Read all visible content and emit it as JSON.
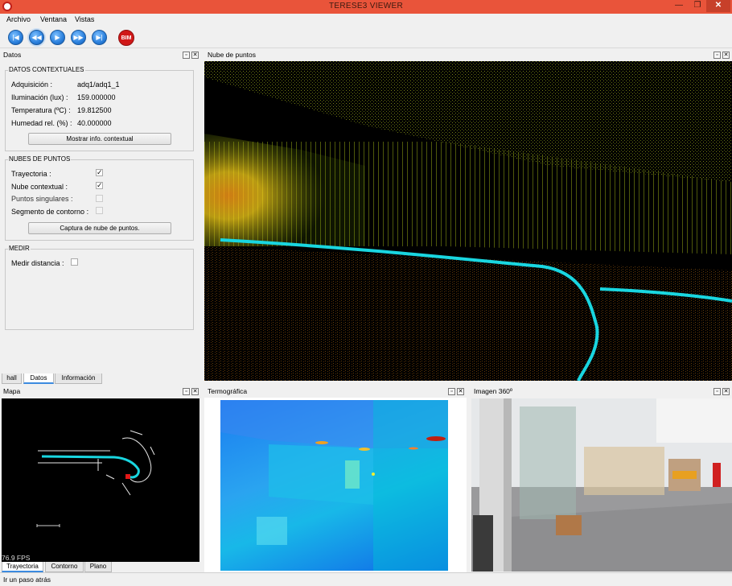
{
  "window": {
    "title": "TERESE3 VIEWER",
    "min": "—",
    "max": "❐",
    "close": "✕"
  },
  "menu": [
    "Archivo",
    "Ventana",
    "Vistas"
  ],
  "toolbar": {
    "bim_label": "BIM"
  },
  "datos_panel": {
    "title": "Datos",
    "contextual": {
      "heading": "DATOS CONTEXTUALES",
      "rows": [
        {
          "label": "Adquisición :",
          "value": "adq1/adq1_1"
        },
        {
          "label": "Iluminación (lux) :",
          "value": "159.000000"
        },
        {
          "label": "Temperatura (ºC) :",
          "value": "19.812500"
        },
        {
          "label": "Humedad rel. (%) :",
          "value": "40.000000"
        }
      ],
      "button": "Mostrar info. contextual"
    },
    "nubes": {
      "heading": "NUBES DE PUNTOS",
      "rows": [
        {
          "label": "Trayectoria :",
          "checked": true,
          "enabled": true
        },
        {
          "label": "Nube contextual :",
          "checked": true,
          "enabled": true
        },
        {
          "label": "Puntos singulares :",
          "checked": false,
          "enabled": false
        },
        {
          "label": "Segmento de contorno :",
          "checked": false,
          "enabled": false
        }
      ],
      "button": "Captura de nube de puntos."
    },
    "medir": {
      "heading": "MEDIR",
      "label": "Medir distancia :",
      "checked": false
    },
    "tabs": [
      "hall",
      "Datos",
      "Información"
    ],
    "selected_tab": "Datos"
  },
  "nube_panel": {
    "title": "Nube de puntos"
  },
  "mapa_panel": {
    "title": "Mapa",
    "fps": "76.9 FPS",
    "tabs": [
      "Trayectoria",
      "Contorno",
      "Plano"
    ],
    "selected_tab": "Trayectoria"
  },
  "termo_panel": {
    "title": "Termográfica"
  },
  "imagen_panel": {
    "title": "Imagen 360º"
  },
  "status": {
    "text": "Ir un paso atrás"
  },
  "colors": {
    "titlebar": "#e9543a",
    "trajectory": "#19d6e0",
    "accent": "#3c8be0"
  }
}
